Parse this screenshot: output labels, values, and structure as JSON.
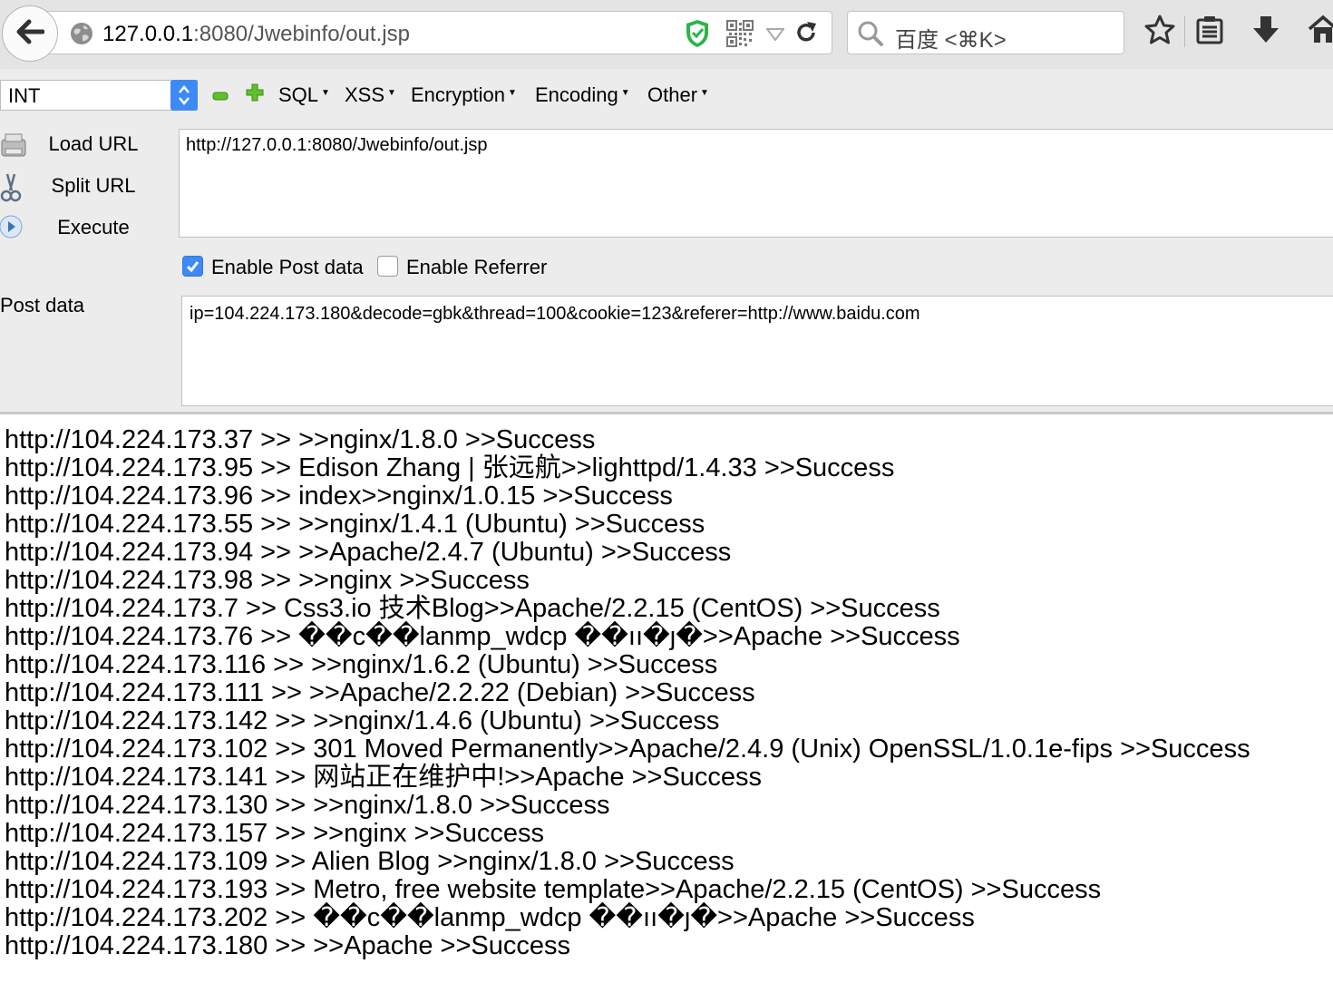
{
  "browser": {
    "url_host": "127.0.0.1",
    "url_rest": ":8080/Jwebinfo/out.jsp",
    "search_placeholder": "百度 <⌘K>",
    "icons": [
      "back-arrow-icon",
      "globe-icon",
      "shield-check-icon",
      "qr-code-icon",
      "dropdown-triangle-icon",
      "reload-icon",
      "search-icon",
      "star-icon",
      "reading-list-icon",
      "download-icon",
      "home-icon"
    ],
    "accent": "#3d8af7"
  },
  "hackbar": {
    "type_select": "INT",
    "menus": [
      "SQL",
      "XSS",
      "Encryption",
      "Encoding",
      "Other"
    ],
    "actions": {
      "load": "Load URL",
      "split": "Split URL",
      "execute": "Execute"
    },
    "url_value": "http://127.0.0.1:8080/Jwebinfo/out.jsp",
    "enable_post": "Enable Post data",
    "enable_referrer": "Enable Referrer",
    "post_label": "Post data",
    "post_value": "ip=104.224.173.180&decode=gbk&thread=100&cookie=123&referer=http://www.baidu.com"
  },
  "output": {
    "lines": [
      "http://104.224.173.37 >> >>nginx/1.8.0 >>Success",
      "http://104.224.173.95 >> Edison Zhang | 张远航>>lighttpd/1.4.33 >>Success",
      "http://104.224.173.96 >> index>>nginx/1.0.15 >>Success",
      "http://104.224.173.55 >> >>nginx/1.4.1 (Ubuntu) >>Success",
      "http://104.224.173.94 >> >>Apache/2.4.7 (Ubuntu) >>Success",
      "http://104.224.173.98 >> >>nginx >>Success",
      "http://104.224.173.7 >> Css3.io 技术Blog>>Apache/2.2.15 (CentOS) >>Success",
      "http://104.224.173.76 >> ��c��lanmp_wdcp ��ıı�ȷ�>>Apache >>Success",
      "http://104.224.173.116 >> >>nginx/1.6.2 (Ubuntu) >>Success",
      "http://104.224.173.111 >> >>Apache/2.2.22 (Debian) >>Success",
      "http://104.224.173.142 >> >>nginx/1.4.6 (Ubuntu) >>Success",
      "http://104.224.173.102 >> 301 Moved Permanently>>Apache/2.4.9 (Unix) OpenSSL/1.0.1e-fips >>Success",
      "http://104.224.173.141 >> 网站正在维护中!>>Apache >>Success",
      "http://104.224.173.130 >> >>nginx/1.8.0 >>Success",
      "http://104.224.173.157 >> >>nginx >>Success",
      "http://104.224.173.109 >> Alien Blog >>nginx/1.8.0 >>Success",
      "http://104.224.173.193 >> Metro, free website template>>Apache/2.2.15 (CentOS) >>Success",
      "http://104.224.173.202 >> ��c��lanmp_wdcp ��ıı�ȷ�>>Apache >>Success",
      "http://104.224.173.180 >> >>Apache >>Success"
    ]
  }
}
